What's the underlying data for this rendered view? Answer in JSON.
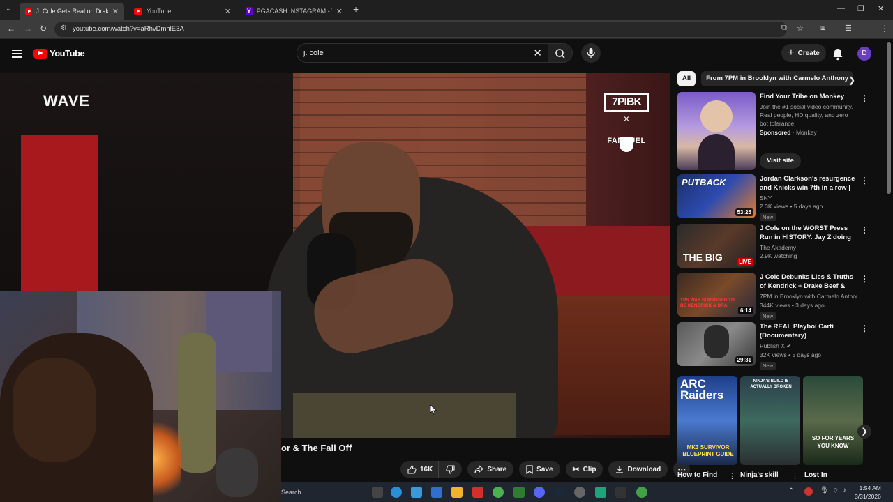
{
  "browser": {
    "tabs": [
      {
        "title": "J. Cole Gets Real on Drake & Ke",
        "icon": "youtube-icon",
        "active": true
      },
      {
        "title": "YouTube",
        "icon": "youtube-icon",
        "active": false
      },
      {
        "title": "PGACASH INSTAGRAM - Yahoo",
        "icon": "yahoo-icon",
        "active": false
      }
    ],
    "new_tab": "+",
    "url": "youtube.com/watch?v=aRhvDmhlE3A"
  },
  "youtube": {
    "logo_text": "YouTube",
    "search": {
      "value": "j. cole",
      "clear": "✕"
    },
    "create_label": "Create",
    "avatar_letter": "D"
  },
  "video": {
    "overlay_brand": "WAVE",
    "sponsor_top": "7PIBK",
    "sponsor_x": "×",
    "sponsor_bottom": "FANDUEL",
    "title_visible": "or & The Fall Off",
    "actions": {
      "like_count": "16K",
      "share": "Share",
      "save": "Save",
      "clip": "Clip",
      "download": "Download"
    }
  },
  "sidebar": {
    "chips": [
      "All",
      "From 7PM in Brooklyn with Carmelo Anthony"
    ],
    "ad": {
      "title": "Find Your Tribe on Monkey",
      "description": "Join the #1 social video community. Real people, HD quality, and zero bot tolerance.",
      "sponsored": "Sponsored",
      "advertiser": "Monkey",
      "cta": "Visit site"
    },
    "recommendations": [
      {
        "title": "Jordan Clarkson's resurgence and Knicks win 7th in a row | ...",
        "channel": "SNY",
        "meta": "2.3K views • 5 days ago",
        "badge": "New",
        "duration": "53:25",
        "thumb_text": "PUTBACK"
      },
      {
        "title": "J Cole on the WORST Press Run in HISTORY. Jay Z doing the ...",
        "channel": "The Akademy",
        "meta": "2.9K watching",
        "badge": "",
        "duration": "LIVE",
        "thumb_text": "THE BIG"
      },
      {
        "title": "J Cole Debunks Lies & Truths of Kendrick + Drake Beef & Gets ...",
        "channel": "7PM in Brooklyn with Carmelo Anthony",
        "meta": "344K views • 3 days ago",
        "badge": "New",
        "duration": "6:14",
        "thumb_text": "TPS WAS SUPPOSED TO BE KENDRICK & DRA"
      },
      {
        "title": "The REAL Playboi Carti (Documentary)",
        "channel": "Publish X",
        "meta": "32K views • 5 days ago",
        "badge": "New",
        "duration": "29:31",
        "thumb_text": ""
      }
    ],
    "shelf": [
      {
        "title": "How to Find",
        "thumb_text": "ARC Raiders",
        "sub_text": "MK3 SURVIVOR BLUEPRINT GUIDE"
      },
      {
        "title": "Ninja's skill",
        "thumb_text": "NINJA'S BUILD IS ACTUALLY BROKEN",
        "sub_text": ""
      },
      {
        "title": "Lost In",
        "thumb_text": "SO FOR YEARS YOU KNOW",
        "sub_text": ""
      }
    ]
  },
  "taskbar": {
    "search_label": "Search",
    "time": "1:54 AM",
    "date": "3/31/2026"
  },
  "colors": {
    "brand_red": "#ff0000",
    "bg": "#0f0f0f",
    "chip_bg": "#272727"
  }
}
